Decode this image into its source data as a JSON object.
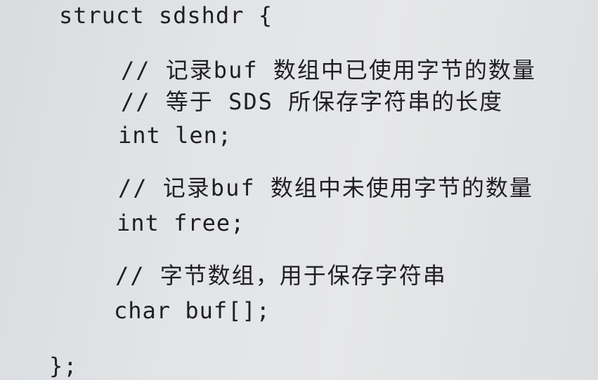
{
  "code": {
    "struct_open": "struct sdshdr {",
    "comment_len_1": "// 记录buf 数组中已使用字节的数量",
    "comment_len_2": "// 等于 SDS 所保存字符串的长度",
    "field_len": "int len;",
    "comment_free": "// 记录buf 数组中未使用字节的数量",
    "field_free": "int free;",
    "comment_buf": "// 字节数组，用于保存字符串",
    "field_buf": "char buf[];",
    "struct_close": "};"
  }
}
